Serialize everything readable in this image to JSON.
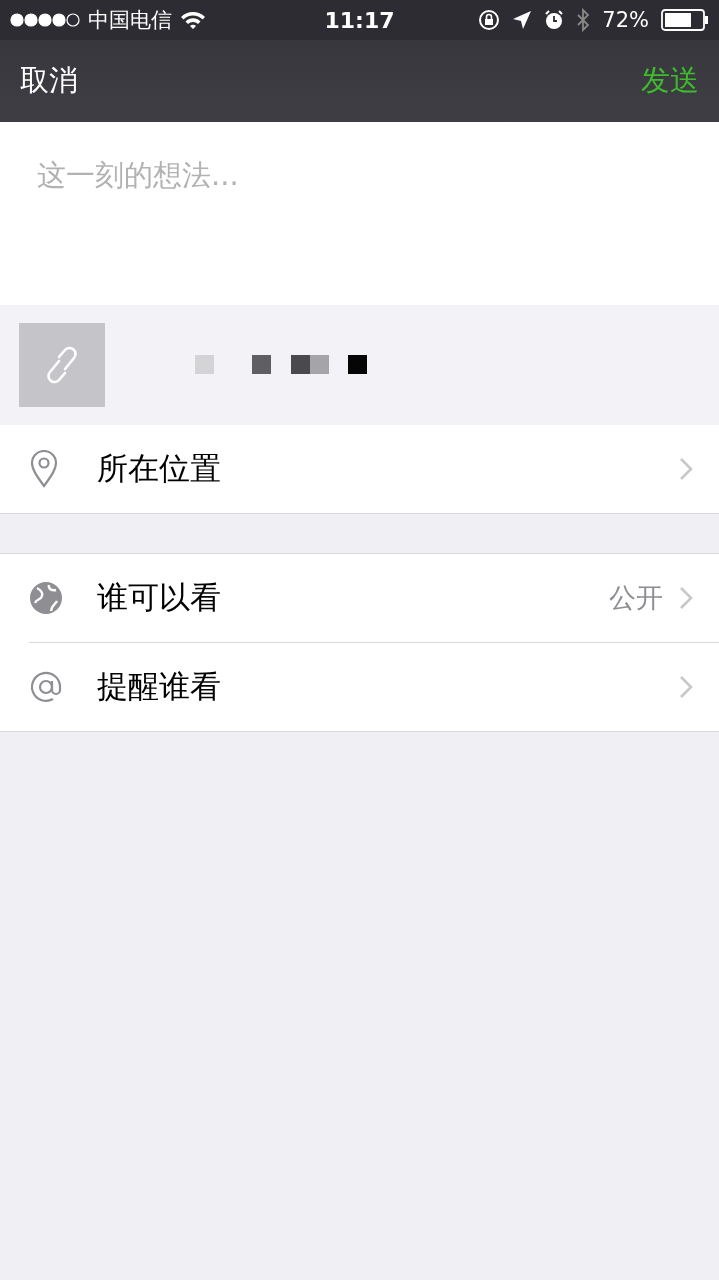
{
  "status_bar": {
    "carrier": "中国电信",
    "time": "11:17",
    "battery": "72%"
  },
  "nav_bar": {
    "cancel": "取消",
    "send": "发送"
  },
  "composer": {
    "placeholder": "这一刻的想法..."
  },
  "option_groups": [
    {
      "items": [
        {
          "kind": "location",
          "label": "所在位置"
        }
      ]
    },
    {
      "items": [
        {
          "kind": "visibility",
          "label": "谁可以看",
          "value": "公开"
        },
        {
          "kind": "mention",
          "label": "提醒谁看"
        }
      ]
    }
  ]
}
